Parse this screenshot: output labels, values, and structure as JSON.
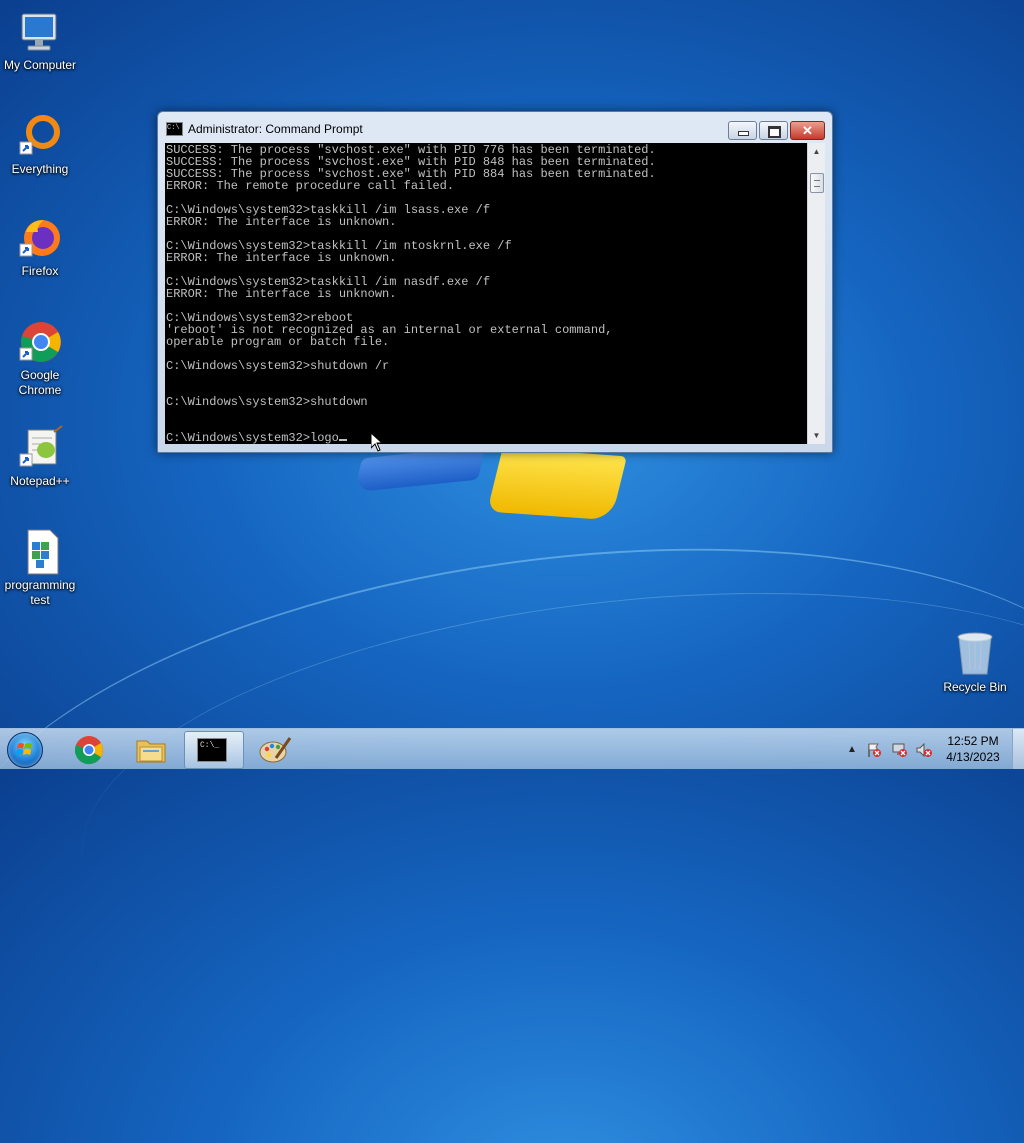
{
  "desktop": {
    "icons": [
      {
        "label": "My Computer",
        "icon": "computer-icon"
      },
      {
        "label": "Everything",
        "icon": "everything-icon"
      },
      {
        "label": "Firefox",
        "icon": "firefox-icon"
      },
      {
        "label": "Google Chrome",
        "icon": "chrome-icon"
      },
      {
        "label": "Notepad++",
        "icon": "notepadpp-icon"
      },
      {
        "label": "programming test",
        "icon": "registry-file-icon"
      },
      {
        "label": "Recycle Bin",
        "icon": "recycle-bin-icon"
      }
    ]
  },
  "window": {
    "title": "Administrator: Command Prompt",
    "icon_text": "C:\\",
    "close_glyph": "✕"
  },
  "console": {
    "lines": [
      "SUCCESS: The process \"svchost.exe\" with PID 776 has been terminated.",
      "SUCCESS: The process \"svchost.exe\" with PID 848 has been terminated.",
      "SUCCESS: The process \"svchost.exe\" with PID 884 has been terminated.",
      "ERROR: The remote procedure call failed.",
      "",
      "C:\\Windows\\system32>taskkill /im lsass.exe /f",
      "ERROR: The interface is unknown.",
      "",
      "C:\\Windows\\system32>taskkill /im ntoskrnl.exe /f",
      "ERROR: The interface is unknown.",
      "",
      "C:\\Windows\\system32>taskkill /im nasdf.exe /f",
      "ERROR: The interface is unknown.",
      "",
      "C:\\Windows\\system32>reboot",
      "'reboot' is not recognized as an internal or external command,",
      "operable program or batch file.",
      "",
      "C:\\Windows\\system32>shutdown /r",
      "",
      "",
      "C:\\Windows\\system32>shutdown",
      "",
      ""
    ],
    "prompt_line": "C:\\Windows\\system32>logo"
  },
  "taskbar": {
    "pinned": [
      {
        "name": "chrome",
        "icon": "chrome-icon"
      },
      {
        "name": "explorer",
        "icon": "folder-icon"
      },
      {
        "name": "cmd",
        "icon": "cmd-icon",
        "active": true
      },
      {
        "name": "paint",
        "icon": "paint-icon"
      }
    ],
    "tray_arrow": "▲",
    "clock_time": "12:52 PM",
    "clock_date": "4/13/2023"
  }
}
